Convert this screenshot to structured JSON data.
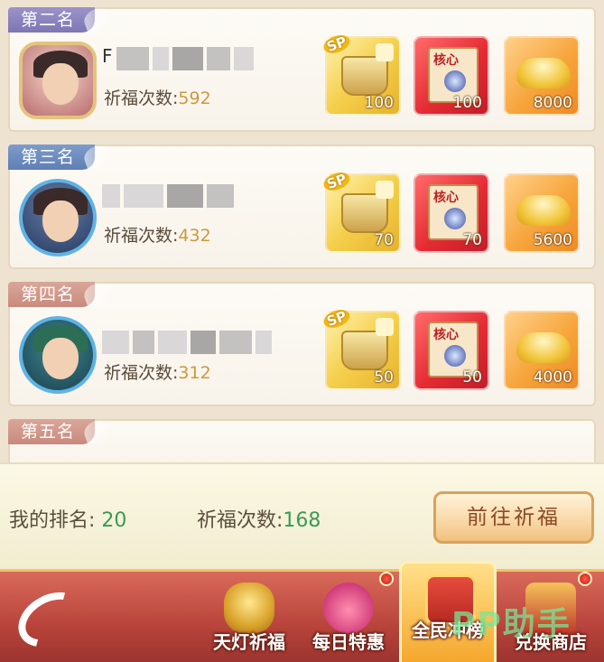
{
  "ranks": [
    {
      "title": "第二名",
      "name_visible_initial": "F",
      "count_label": "祈福次数:",
      "count": "592",
      "rewards": [
        {
          "type": "sp-cauldron-fragment",
          "qty": "100"
        },
        {
          "type": "core-fragment",
          "qty": "100"
        },
        {
          "type": "gold-ingot",
          "qty": "8000"
        }
      ]
    },
    {
      "title": "第三名",
      "name_visible_initial": "",
      "count_label": "祈福次数:",
      "count": "432",
      "rewards": [
        {
          "type": "sp-cauldron-fragment",
          "qty": "70"
        },
        {
          "type": "core-fragment",
          "qty": "70"
        },
        {
          "type": "gold-ingot",
          "qty": "5600"
        }
      ]
    },
    {
      "title": "第四名",
      "name_visible_initial": "",
      "count_label": "祈福次数:",
      "count": "312",
      "rewards": [
        {
          "type": "sp-cauldron-fragment",
          "qty": "50"
        },
        {
          "type": "core-fragment",
          "qty": "50"
        },
        {
          "type": "gold-ingot",
          "qty": "4000"
        }
      ]
    },
    {
      "title": "第五名"
    }
  ],
  "reward_badges": {
    "sp": "SP",
    "core": "核心"
  },
  "my_status": {
    "rank_label": "我的排名:",
    "rank_value": "20",
    "count_label": "祈福次数:",
    "count_value": "168",
    "go_button": "前往祈福"
  },
  "nav": {
    "items": [
      {
        "label": "天灯祈福",
        "icon": "lantern-icon"
      },
      {
        "label": "每日特惠",
        "icon": "gift-bag-icon"
      },
      {
        "label": "全民冲榜",
        "icon": "ranking-scroll-icon",
        "active": true
      },
      {
        "label": "兑换商店",
        "icon": "shop-icon"
      }
    ]
  },
  "watermark": "PP助手",
  "colors": {
    "count_value": "#c99a3e",
    "status_value": "#3a9a57",
    "nav_bg": "#b8443b",
    "active_tab": "#f5a72d"
  }
}
